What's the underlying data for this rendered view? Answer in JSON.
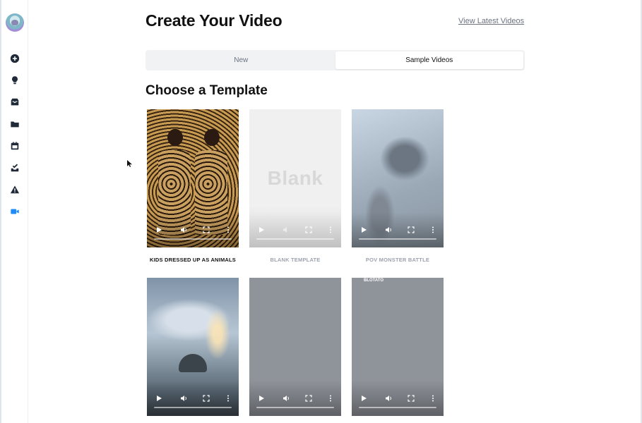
{
  "header": {
    "title": "Create Your Video",
    "latest_link": "View Latest Videos"
  },
  "tabs": [
    {
      "label": "New",
      "active": false
    },
    {
      "label": "Sample Videos",
      "active": true
    }
  ],
  "section": {
    "title": "Choose a Template"
  },
  "sidebar": {
    "items": [
      {
        "icon": "add-circle-icon"
      },
      {
        "icon": "lightbulb-icon"
      },
      {
        "icon": "inbox-icon"
      },
      {
        "icon": "folder-icon"
      },
      {
        "icon": "calendar-icon"
      },
      {
        "icon": "tray-check-icon"
      },
      {
        "icon": "warning-icon"
      },
      {
        "icon": "video-camera-icon",
        "active": true
      }
    ],
    "active_color": "#1d8cf8"
  },
  "templates": [
    {
      "caption": "KIDS DRESSED UP AS ANIMALS",
      "style": "kids"
    },
    {
      "caption": "BLANK TEMPLATE",
      "style": "blank",
      "thumb_text": "Blank"
    },
    {
      "caption": "POV MONSTER BATTLE",
      "style": "monster"
    },
    {
      "caption": "",
      "style": "storm"
    },
    {
      "caption": "",
      "style": "gray"
    },
    {
      "caption": "",
      "style": "gray",
      "overlay_text": "BLOTATO"
    }
  ]
}
